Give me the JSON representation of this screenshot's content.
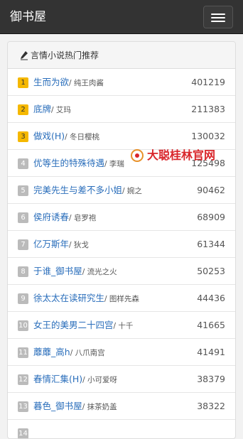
{
  "header": {
    "title": "御书屋",
    "menu_icon": "hamburger-menu-icon"
  },
  "panel": {
    "heading": "言情小说热门推荐",
    "heading_icon": "pen-icon"
  },
  "books": [
    {
      "rank": "1",
      "title": "生而为欲",
      "author": "/ 纯王肉酱",
      "count": "401219",
      "highlight": true
    },
    {
      "rank": "2",
      "title": "底牌",
      "author": "/ 艾玛",
      "count": "211383",
      "highlight": true
    },
    {
      "rank": "3",
      "title": "做戏(H)",
      "author": "/ 冬日樱桃",
      "count": "130032",
      "highlight": true
    },
    {
      "rank": "4",
      "title": "优等生的特殊待遇",
      "author": "/ 李瑞",
      "count": "125498",
      "highlight": false
    },
    {
      "rank": "5",
      "title": "完美先生与差不多小姐",
      "author": "/ 婉之",
      "count": "90462",
      "highlight": false
    },
    {
      "rank": "6",
      "title": "侯府诱春",
      "author": "/ 皂罗袍",
      "count": "68909",
      "highlight": false
    },
    {
      "rank": "7",
      "title": "亿万斯年",
      "author": "/ 狄戈",
      "count": "61344",
      "highlight": false
    },
    {
      "rank": "8",
      "title": "于谁_御书屋",
      "author": "/ 流光之火",
      "count": "50253",
      "highlight": false
    },
    {
      "rank": "9",
      "title": "徐太太在读研究生",
      "author": "/ 图样先森",
      "count": "44436",
      "highlight": false
    },
    {
      "rank": "10",
      "title": "女王的美男二十四宫",
      "author": "/ 十千",
      "count": "41665",
      "highlight": false
    },
    {
      "rank": "11",
      "title": "蘼蘼_高h",
      "author": "/ 八爪南宫",
      "count": "41491",
      "highlight": false
    },
    {
      "rank": "12",
      "title": "春情汇集(H)",
      "author": "/ 小可爱呀",
      "count": "38379",
      "highlight": false
    },
    {
      "rank": "13",
      "title": "暮色_御书屋",
      "author": "/ 抹茶奶盖",
      "count": "38322",
      "highlight": false
    },
    {
      "rank": "14",
      "title": "",
      "author": "",
      "count": "",
      "highlight": false
    }
  ],
  "watermark": {
    "text": "大聪桂林官网",
    "color": "#d9262b"
  }
}
